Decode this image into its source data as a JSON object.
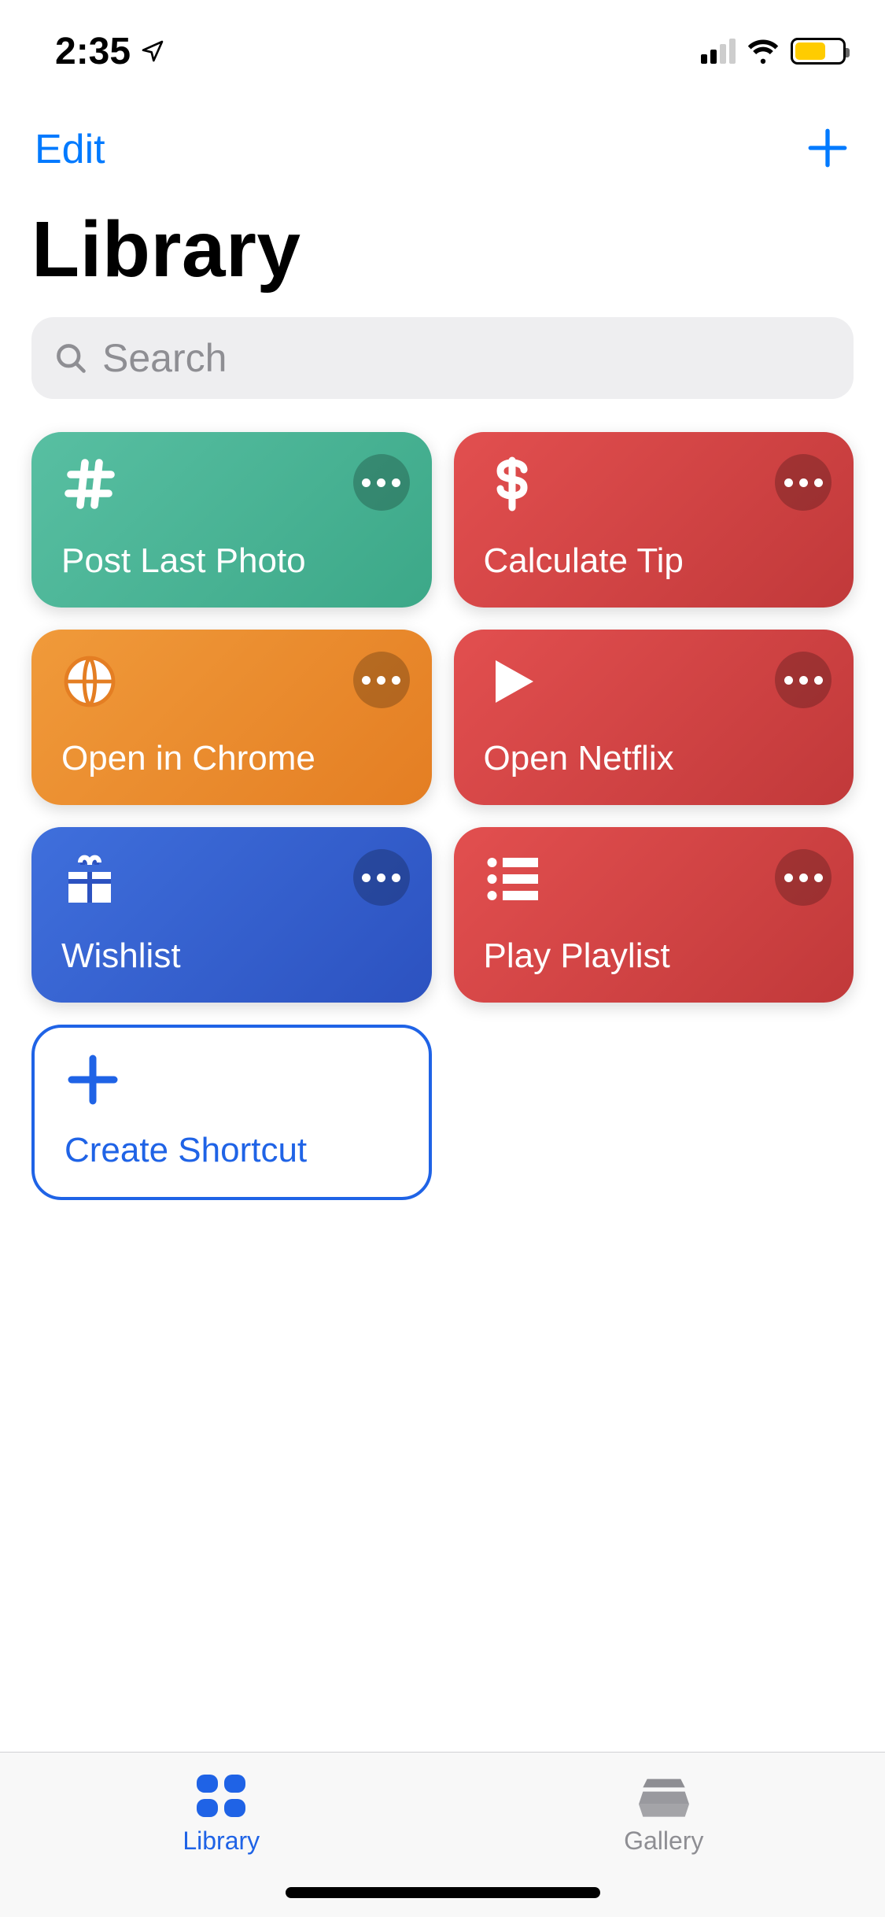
{
  "status": {
    "time": "2:35",
    "location_icon": "location-arrow",
    "signal_bars_active": 2,
    "wifi": true,
    "battery_percent": 60,
    "battery_low_color": "#ffcc00"
  },
  "nav": {
    "edit_label": "Edit",
    "add_icon": "plus-icon"
  },
  "header": {
    "title": "Library"
  },
  "search": {
    "placeholder": "Search",
    "value": ""
  },
  "shortcuts": [
    {
      "label": "Post Last Photo",
      "icon": "hashtag-icon",
      "color": "green",
      "name": "shortcut-post-last-photo"
    },
    {
      "label": "Calculate Tip",
      "icon": "dollar-icon",
      "color": "red",
      "name": "shortcut-calculate-tip"
    },
    {
      "label": "Open in Chrome",
      "icon": "globe-icon",
      "color": "orange",
      "name": "shortcut-open-in-chrome"
    },
    {
      "label": "Open Netflix",
      "icon": "play-icon",
      "color": "red2",
      "name": "shortcut-open-netflix"
    },
    {
      "label": "Wishlist",
      "icon": "gift-icon",
      "color": "blue",
      "name": "shortcut-wishlist"
    },
    {
      "label": "Play Playlist",
      "icon": "list-icon",
      "color": "red3",
      "name": "shortcut-play-playlist"
    }
  ],
  "create": {
    "label": "Create Shortcut",
    "icon": "plus-icon"
  },
  "tabs": {
    "library": {
      "label": "Library",
      "active": true
    },
    "gallery": {
      "label": "Gallery",
      "active": false
    }
  }
}
